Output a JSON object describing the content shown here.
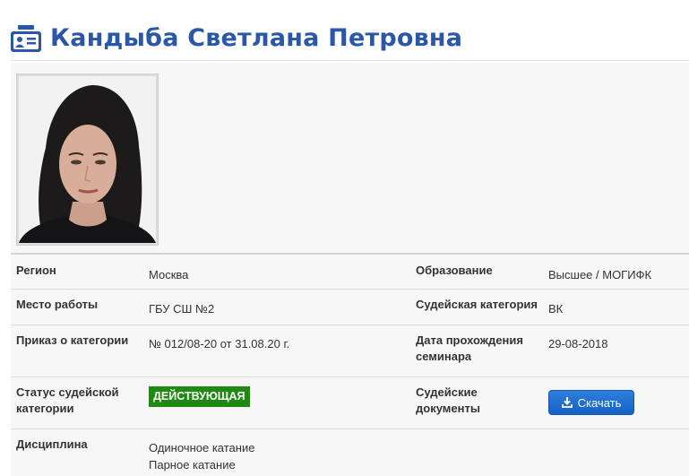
{
  "header": {
    "icon": "judge-id-card-icon",
    "title": "Кандыба Светлана Петровна",
    "accent_color": "#2a57a8"
  },
  "photo": {
    "alt": "photo"
  },
  "details": {
    "region_label": "Регион",
    "region_value": "Москва",
    "education_label": "Образование",
    "education_value": "Высшее / МОГИФК",
    "workplace_label": "Место работы",
    "workplace_value": "ГБУ СШ №2",
    "category_label": "Судейская категория",
    "category_value": "ВК",
    "order_label": "Приказ о категории",
    "order_value": "№ 012/08-20 от 31.08.20 г.",
    "seminar_label_line1": "Дата прохождения",
    "seminar_label_line2": "семинара",
    "seminar_value": "29-08-2018",
    "status_label_line1": "Статус судейской",
    "status_label_line2": "категории",
    "status_value": "ДЕЙСТВУЮЩАЯ",
    "status_color": "#1f8a12",
    "documents_label_line1": "Судейские",
    "documents_label_line2": "документы",
    "download_label": "Скачать",
    "download_icon": "download-icon",
    "discipline_label": "Дисциплина",
    "disciplines": [
      "Одиночное катание",
      "Парное катание"
    ]
  }
}
